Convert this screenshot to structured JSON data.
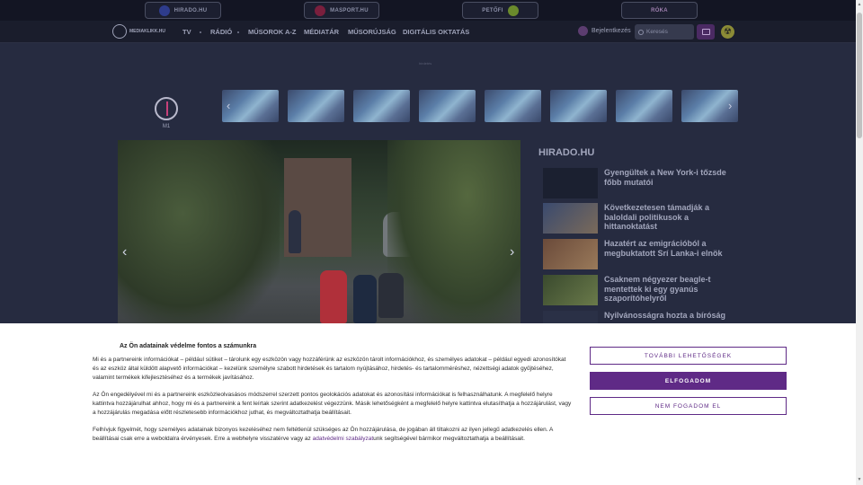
{
  "brands": [
    {
      "label": "HIRADO.HU",
      "dot_color": "#2e3c8c"
    },
    {
      "label": "MASPORT.HU",
      "dot_color": "#7a1f3d"
    },
    {
      "label": "PETŐFI",
      "dot_color": "#6a8a2c"
    },
    {
      "label": "RÓKA",
      "dot_color": "#6b2a70"
    }
  ],
  "nav": {
    "logo": "MEDIAKLIKK.HU",
    "items": [
      "TV",
      "RÁDIÓ",
      "MŰSOROK A-Z",
      "MÉDIATÁR",
      "MŰSORÚJSÁG",
      "DIGITÁLIS OKTATÁS"
    ],
    "login": "Bejelentkezés",
    "search_placeholder": "Keresés"
  },
  "ad_label": "hirdetés",
  "carousel": {
    "first_label": "M1",
    "prev": "‹",
    "next": "›"
  },
  "hero": {
    "prev": "‹",
    "next": "›"
  },
  "side": {
    "title": "HIRADO.HU",
    "items": [
      {
        "text": "Gyengültek a New York-i tőzsde főbb mutatói",
        "thumb": "#1b2030"
      },
      {
        "text": "Következetesen támadják a baloldali politikusok a hittanoktatást",
        "thumb": "#4a5a7a"
      },
      {
        "text": "Hazatért az emigrációból a megbuktatott Srí Lanka-i elnök",
        "thumb": "#7a5a4a"
      },
      {
        "text": "Csaknem négyezer beagle-t mentettek ki egy gyanús szaporítóhelyről",
        "thumb": "#4a5a3a"
      },
      {
        "text": "Nyilvánosságra hozta a bíróság a",
        "thumb": "#2a3046"
      }
    ]
  },
  "consent": {
    "title": "Az Ön adatainak védelme fontos a számunkra",
    "p1": "Mi és a partnereink információkat – például sütiket – tárolunk egy eszközön vagy hozzáférünk az eszközön tárolt információkhoz, és személyes adatokat – például egyedi azonosítókat és az eszköz által küldött alapvető információkat – kezelünk személyre szabott hirdetések és tartalom nyújtásához, hirdetés- és tartalomméréshez, nézettségi adatok gyűjtéséhez, valamint termékek kifejlesztéséhez és a termékek javításához.",
    "p2": "Az Ön engedélyével mi és a partnereink eszközleolvasásos módszerrel szerzett pontos geolokációs adatokat és azonosítási információkat is felhasználhatunk. A megfelelő helyre kattintva hozzájárulhat ahhoz, hogy mi és a partnereink a fent leírtak szerint adatkezelést végezzünk. Másik lehetőségként a megfelelő helyre kattintva elutasíthatja a hozzájárulást, vagy a hozzájárulás megadása előtt részletesebb információkhoz juthat, és megváltoztathatja beállításait.",
    "p3_before": "Felhívjuk figyelmét, hogy személyes adatainak bizonyos kezeléséhez nem feltétlenül szükséges az Ön hozzájárulása, de jogában áll tiltakozni az ilyen jellegű adatkezelés ellen. A beállításai csak erre a weboldalra érvényesek. Erre a webhelyre visszatérve vagy az ",
    "p3_link": "adatvédelmi szabályzat",
    "p3_after": "unk segítségével bármikor megváltoztathatja a beállításait.",
    "btn_more": "TOVÁBBI LEHETŐSÉGEK",
    "btn_accept": "ELFOGADOM",
    "btn_reject": "NEM FOGADOM EL"
  }
}
